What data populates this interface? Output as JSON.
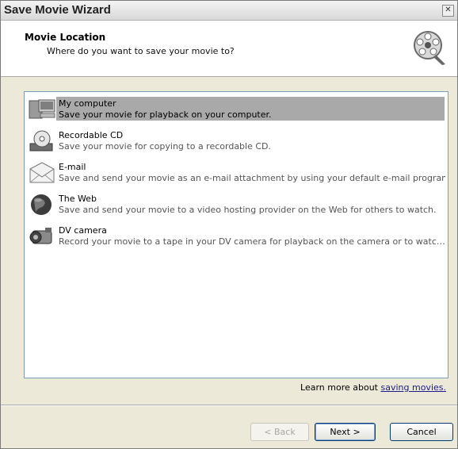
{
  "window": {
    "title": "Save Movie Wizard",
    "close_symbol": "✕"
  },
  "header": {
    "title": "Movie Location",
    "subtitle": "Where do you want to save your movie to?",
    "icon": "film-reel-icon"
  },
  "options": [
    {
      "label": "My computer",
      "description": "Save your movie for playback on your computer.",
      "icon": "computer-icon",
      "selected": true
    },
    {
      "label": "Recordable CD",
      "description": "Save your movie for copying to a recordable CD.",
      "icon": "cd-icon",
      "selected": false
    },
    {
      "label": "E-mail",
      "description": "Save and send your movie as an e-mail attachment by using your default e-mail program.",
      "icon": "envelope-icon",
      "selected": false
    },
    {
      "label": "The Web",
      "description": "Save and send your movie to a video hosting provider on the Web for others to watch.",
      "icon": "globe-icon",
      "selected": false
    },
    {
      "label": "DV camera",
      "description": "Record your movie to a tape in your DV camera for playback on the camera or to watch on a TV.",
      "icon": "dv-camera-icon",
      "selected": false
    }
  ],
  "learn_more": {
    "prefix": "Learn more about ",
    "link": "saving movies."
  },
  "buttons": {
    "back": "< Back",
    "next": "Next >",
    "cancel": "Cancel"
  }
}
